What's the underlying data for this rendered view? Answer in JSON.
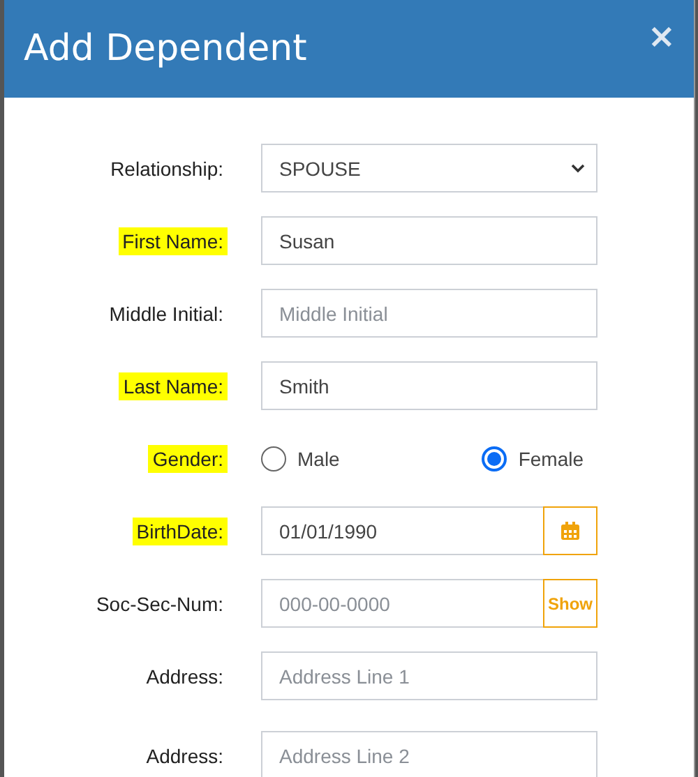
{
  "dialog": {
    "title": "Add Dependent",
    "close": "×"
  },
  "fields": [
    {
      "kind": "select",
      "label": "Relationship:",
      "highlighted": false,
      "value": "SPOUSE"
    },
    {
      "kind": "text",
      "label": "First Name:",
      "highlighted": true,
      "value": "Susan"
    },
    {
      "kind": "text",
      "label": "Middle Initial:",
      "highlighted": false,
      "placeholder": "Middle Initial"
    },
    {
      "kind": "text",
      "label": "Last Name:",
      "highlighted": true,
      "value": "Smith"
    },
    {
      "kind": "radio",
      "label": "Gender:",
      "highlighted": true,
      "options": [
        {
          "label": "Male",
          "selected": false
        },
        {
          "label": "Female",
          "selected": true
        }
      ]
    },
    {
      "kind": "date",
      "label": "BirthDate:",
      "highlighted": true,
      "value": "01/01/1990"
    },
    {
      "kind": "ssn",
      "label": "Soc-Sec-Num:",
      "highlighted": false,
      "placeholder": "000-00-0000",
      "button": "Show"
    },
    {
      "kind": "text",
      "label": "Address:",
      "highlighted": false,
      "placeholder": "Address Line 1"
    },
    {
      "kind": "text",
      "label": "Address:",
      "highlighted": false,
      "placeholder": "Address Line 2"
    }
  ]
}
